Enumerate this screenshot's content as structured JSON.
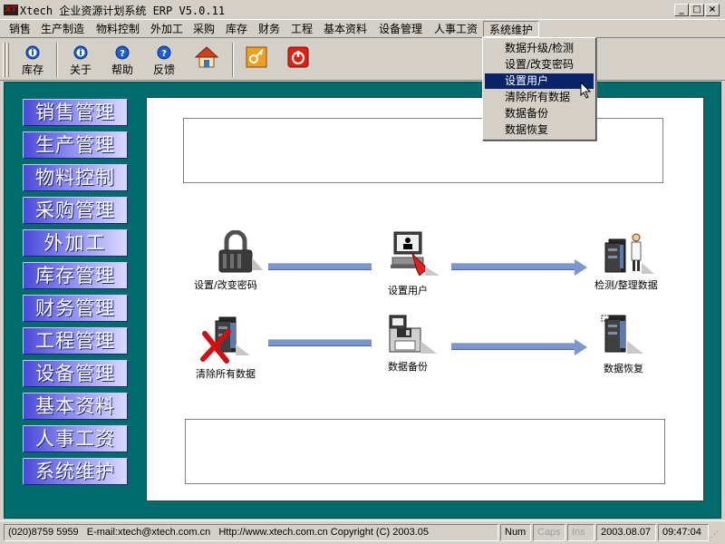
{
  "window": {
    "title": "Xtech 企业资源计划系统 ERP V5.0.11",
    "app_icon": "XT"
  },
  "menubar": [
    "销售",
    "生产制造",
    "物料控制",
    "外加工",
    "采购",
    "库存",
    "财务",
    "工程",
    "基本资料",
    "设备管理",
    "人事工资",
    "系统维护"
  ],
  "toolbar": {
    "buttons": [
      {
        "label": "库存",
        "icon": "info-icon"
      },
      {
        "label": "关于",
        "icon": "info-icon"
      },
      {
        "label": "帮助",
        "icon": "help-icon"
      },
      {
        "label": "反馈",
        "icon": "help-icon"
      },
      {
        "label": "",
        "icon": "home-icon"
      },
      {
        "label": "",
        "icon": "key-icon"
      },
      {
        "label": "",
        "icon": "power-icon"
      }
    ]
  },
  "dropdown": {
    "items": [
      "数据升级/检测",
      "设置/改变密码",
      "设置用户",
      "清除所有数据",
      "数据备份",
      "数据恢复"
    ],
    "highlighted_index": 2
  },
  "nav": [
    "销售管理",
    "生产管理",
    "物料控制",
    "采购管理",
    "外加工",
    "库存管理",
    "财务管理",
    "工程管理",
    "设备管理",
    "基本资料",
    "人事工资",
    "系统维护"
  ],
  "functions": {
    "change_password": "设置/改变密码",
    "set_user": "设置用户",
    "check_data": "检测/整理数据",
    "clear_data": "清除所有数据",
    "backup": "数据备份",
    "restore": "数据恢复"
  },
  "statusbar": {
    "phone": "(020)8759 5959",
    "email": "E-mail:xtech@xtech.com.cn",
    "website": "Http://www.xtech.com.cn Copyright (C) 2003.05",
    "num": "Num",
    "caps": "Caps",
    "ins": "Ins",
    "date": "2003.08.07",
    "time": "09:47:04"
  },
  "colors": {
    "workspace": "#006b6b",
    "nav_button": "#8c8cf0",
    "highlight": "#0a246a",
    "arrow": "#7a96cc"
  }
}
